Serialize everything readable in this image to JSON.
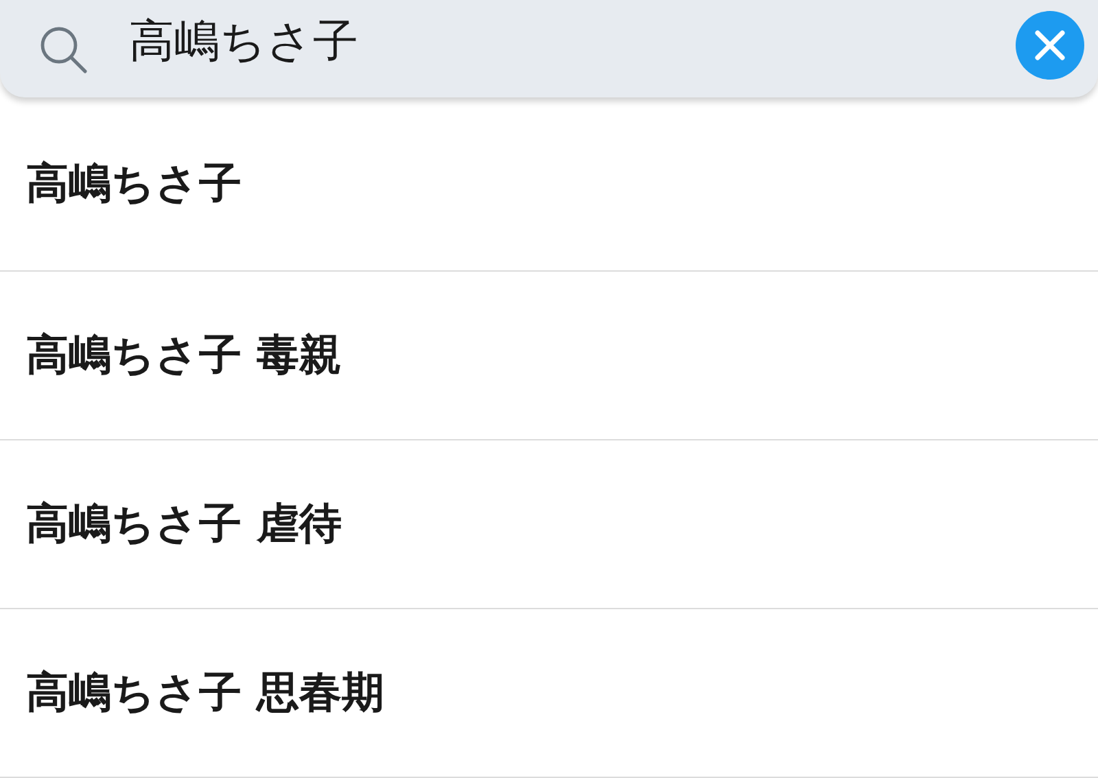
{
  "search": {
    "value": "高嶋ちさ子"
  },
  "suggestions": [
    {
      "text": "高嶋ちさ子"
    },
    {
      "text": "高嶋ちさ子 毒親"
    },
    {
      "text": "高嶋ちさ子 虐待"
    },
    {
      "text": "高嶋ちさ子 思春期"
    }
  ]
}
